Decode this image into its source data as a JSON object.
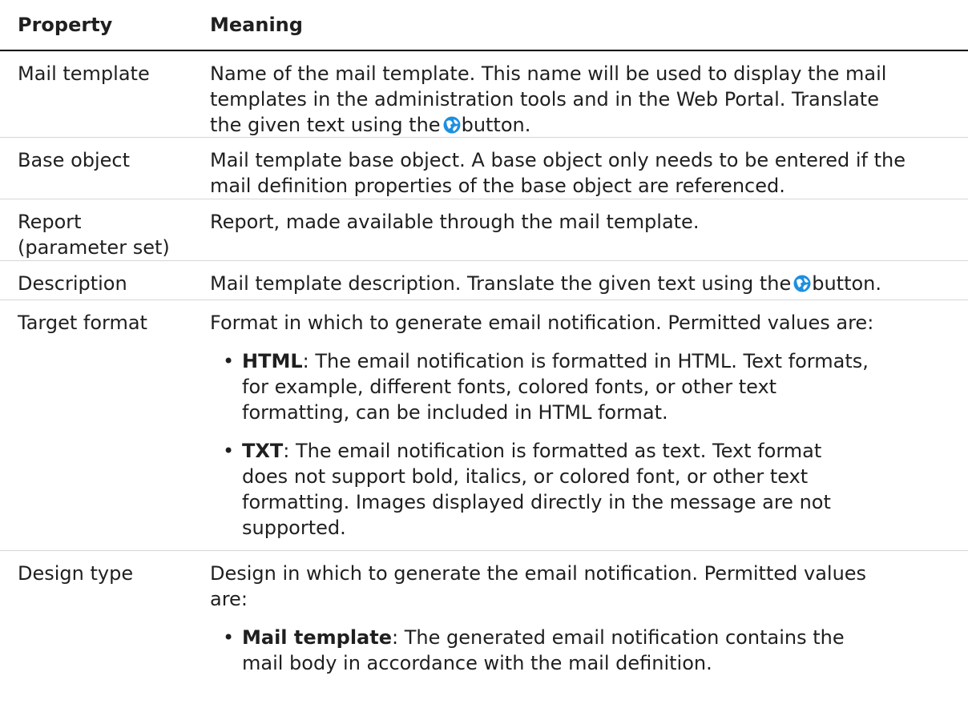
{
  "headers": {
    "property": "Property",
    "meaning": "Meaning"
  },
  "rows": [
    {
      "property": "Mail template",
      "lines": [
        "Name of the mail template. This name will be used to display the mail",
        "templates in the administration tools and in the Web Portal. Translate",
        "the given text using the",
        "button."
      ]
    },
    {
      "property": "Base object",
      "lines": [
        "Mail template base object. A base object only needs to be entered if the",
        "mail definition properties of the base object are referenced."
      ]
    },
    {
      "property_lines": [
        "Report",
        "(parameter set)"
      ],
      "lines": [
        "Report, made available through the mail template."
      ]
    },
    {
      "property": "Description",
      "lines": [
        "Mail template description. Translate the given text using the",
        "button."
      ]
    },
    {
      "property": "Target format",
      "intro": "Format in which to generate email notification. Permitted values are:",
      "bullets": [
        {
          "term": "HTML",
          "lines": [
            ": The email notification is formatted in HTML. Text formats,",
            "for example, different fonts, colored fonts, or other text",
            "formatting, can be included in HTML format."
          ]
        },
        {
          "term": "TXT",
          "lines": [
            ": The email notification is formatted as text. Text format",
            "does not support bold, italics, or colored font, or other text",
            "formatting. Images displayed directly in the message are not",
            "supported."
          ]
        }
      ]
    },
    {
      "property": "Design type",
      "intro_lines": [
        "Design in which to generate the email notification. Permitted values",
        "are:"
      ],
      "bullets": [
        {
          "term": "Mail template",
          "lines": [
            ": The generated email notification contains the",
            "mail body in accordance with the mail definition."
          ]
        }
      ]
    }
  ],
  "bullet_char": "•",
  "icon": "translate-globe-icon",
  "icon_color": "#1e8fe0"
}
